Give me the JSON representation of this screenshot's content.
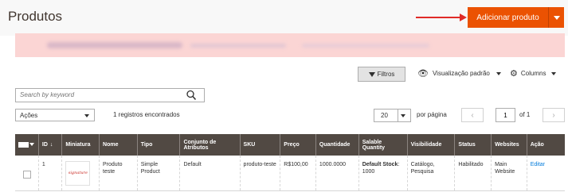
{
  "header": {
    "title": "Produtos",
    "add_button_label": "Adicionar produto"
  },
  "toolbar": {
    "filters_label": "Filtros",
    "view_label": "Visualização padrão",
    "columns_label": "Columns"
  },
  "search": {
    "placeholder": "Search by keyword"
  },
  "actions": {
    "select_label": "Ações",
    "records_text": "1 registros encontrados"
  },
  "pagination": {
    "per_page_value": "20",
    "per_page_label": "por página",
    "current_page": "1",
    "of_text": "of 1",
    "prev_symbol": "‹",
    "next_symbol": "›"
  },
  "grid": {
    "columns": {
      "id": "ID",
      "id_sort": "↓",
      "thumbnail": "Miniatura",
      "name": "Nome",
      "type": "Tipo",
      "attribute_set": "Conjunto de Atributos",
      "sku": "SKU",
      "price": "Preço",
      "quantity": "Quantidade",
      "salable": "Salable Quantity",
      "visibility": "Visibilidade",
      "status": "Status",
      "websites": "Websites",
      "action": "Ação"
    },
    "rows": [
      {
        "id": "1",
        "thumb_text": "signature",
        "name": "Produto teste",
        "type": "Simple Product",
        "attribute_set": "Default",
        "sku": "produto-teste",
        "price": "R$100,00",
        "quantity": "1000.0000",
        "salable_source": "Default Stock",
        "salable_qty": ": 1000",
        "visibility": "Catálogo, Pesquisa",
        "status": "Habilitado",
        "websites": "Main Website",
        "action": "Editar"
      }
    ]
  },
  "colors": {
    "accent": "#eb5202",
    "header_dark": "#514943",
    "notice_bg": "#fbd5d4",
    "link": "#007bdb",
    "arrow": "#e02b27"
  }
}
